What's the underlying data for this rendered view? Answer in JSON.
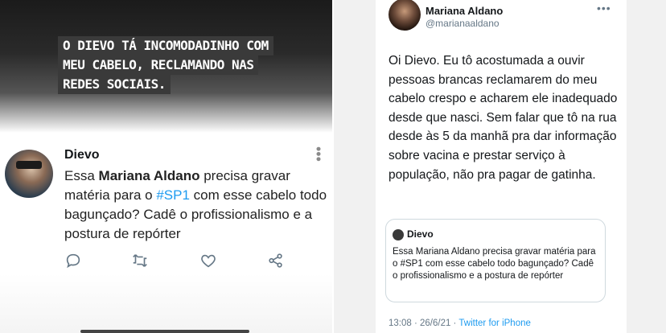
{
  "story": {
    "caption_lines": [
      "O DIEVO TÁ INCOMODADINHO COM",
      "MEU CABELO, RECLAMANDO NAS",
      "REDES SOCIAIS."
    ]
  },
  "left_tweet": {
    "author": "Dievo",
    "text_parts": {
      "p1": "Essa ",
      "mention": "Mariana Aldano",
      "p2": " precisa gravar matéria para o ",
      "hashtag": "#SP1",
      "p3": " com esse cabelo todo bagunçado? Cadê o profissionalismo e a postura de repórter"
    },
    "actions": [
      "reply-icon",
      "retweet-icon",
      "like-icon",
      "share-icon"
    ]
  },
  "right_tweet": {
    "author": "Mariana Aldano",
    "handle": "@marianaaldano",
    "more": "•••",
    "body": "Oi Dievo. Eu tô acostumada a ouvir pessoas brancas reclamarem do meu cabelo crespo e acharem ele inadequado desde que nasci. Sem falar que tô na rua desde às 5 da manhã pra dar informação sobre vacina e prestar serviço à população, não pra pagar de gatinha.",
    "quoted": {
      "author": "Dievo",
      "text": "Essa Mariana Aldano precisa gravar matéria para o #SP1 com esse cabelo todo bagunçado? Cadê o profissionalismo e a postura de repórter"
    },
    "meta": {
      "time_date": "13:08 · 26/6/21 · ",
      "client": "Twitter for iPhone"
    }
  },
  "colors": {
    "link": "#1d9bf0",
    "muted": "#657786",
    "caption_bg": "#3a3a3a"
  }
}
